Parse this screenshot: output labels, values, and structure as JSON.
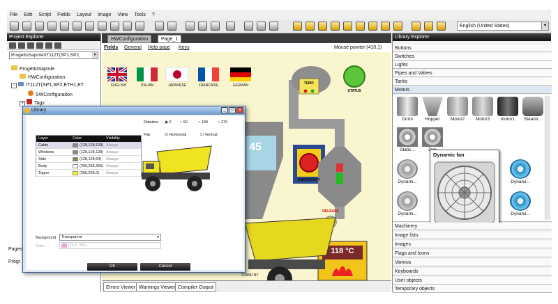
{
  "menu": [
    "File",
    "Edit",
    "Script",
    "Fields",
    "Layout",
    "Image",
    "View",
    "Tools",
    "?"
  ],
  "language": "English (United States)",
  "project_explorer": {
    "title": "Project Explorer",
    "combo": "ProgettoSapmle\\IT112T(SP1,SP2,",
    "tree": [
      "ProgettoSapmle",
      "HWConfiguration",
      "IT112T(SP1,SP2,ETH1,ET",
      "SWConfiguration",
      "Tags"
    ],
    "pages_label": "Pages",
    "prog_label": "Progr"
  },
  "center": {
    "tabs": [
      "HWConfiguration",
      "Page_1"
    ],
    "fields_bar": [
      "Fields",
      "General",
      "Help page",
      "Keys"
    ],
    "mouse_pointer": "Mouse pointer:(410,1)",
    "bottom_tabs": [
      "Errors Viewer",
      "Warnings Viewer",
      "Compiler Output"
    ]
  },
  "canvas": {
    "flags": [
      "ENGLISH",
      "ITALIAN",
      "JAPANESE",
      "FRANCAISE",
      "GERMAN"
    ],
    "temp": "TEMP.",
    "status": "STATUS",
    "value": "45",
    "emergency": "EMERGENCY",
    "release": "RELEASE",
    "temperature": "118 °C",
    "stand_by": "STAND BY"
  },
  "dialog": {
    "title": "Library",
    "rotation_label": "Rotation:",
    "rotations": [
      "0",
      "90",
      "180",
      "270"
    ],
    "flip_label": "Flip:",
    "flip_h": "Horizontal",
    "flip_v": "Vertical",
    "table_headers": [
      "Layer",
      "Color",
      "Visibility"
    ],
    "layers": [
      {
        "name": "Cabin",
        "color": "(128,128,128)",
        "vis": "Always",
        "sw": "#8a8a8a"
      },
      {
        "name": "Windows",
        "color": "(128,128,128)",
        "vis": "Always",
        "sw": "#8a8a8a"
      },
      {
        "name": "Side",
        "color": "(128,128,64)",
        "vis": "Always",
        "sw": "#8a8a44"
      },
      {
        "name": "Body",
        "color": "(255,255,255)",
        "vis": "Always",
        "sw": "#ffffff"
      },
      {
        "name": "Tipper",
        "color": "(255,255,0)",
        "vis": "Always",
        "sw": "#ffff00"
      }
    ],
    "background_label": "Background",
    "background_value": "Transparent",
    "color_label": "Color",
    "color_value": "[25.0, 255]",
    "ok": "OK",
    "cancel": "Cancel"
  },
  "library": {
    "title": "Library Explorer",
    "top_categories": [
      "Buttons",
      "Switches",
      "Lights",
      "Pipes and Valves",
      "Tanks",
      "Motors"
    ],
    "gallery_row1": [
      "Drum",
      "Hopper",
      "Motor2",
      "Motor3",
      "motor1",
      "Steamr..."
    ],
    "gallery_labels": [
      "Static...",
      "Dyn",
      "Dynami...",
      "Dynami...",
      "Dynami...",
      "Dynami..."
    ],
    "tooltip_title": "Dynamic fan",
    "bottom_categories": [
      "Machinery",
      "Image lists",
      "Images",
      "Flags and Icons",
      "Various",
      "Keyboards",
      "User objects",
      "Temporary objects"
    ]
  }
}
